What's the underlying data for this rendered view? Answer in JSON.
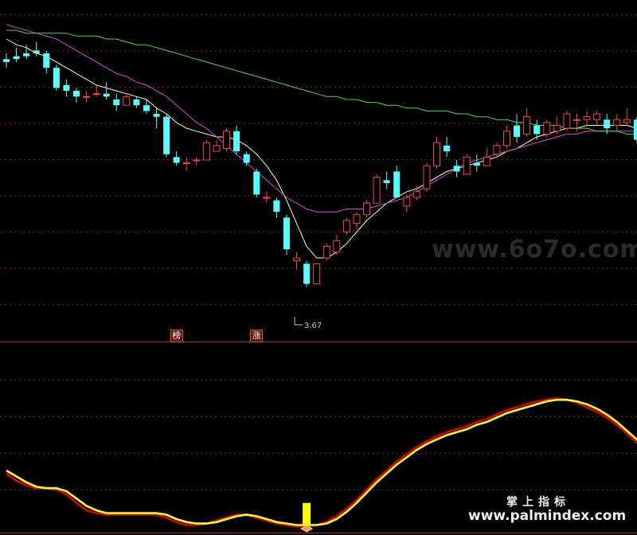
{
  "watermarks": {
    "main": "www.6o7o.com",
    "cn": "掌上指标",
    "url": "www.palmindex.com"
  },
  "badges": [
    {
      "text": "榜",
      "index": 17
    },
    {
      "text": "涨",
      "index": 25
    }
  ],
  "chart_data": [
    {
      "type": "candlestick",
      "title": "",
      "low_annotation": {
        "text": "3.67",
        "index": 18,
        "value": 3.67
      },
      "ylim": [
        3.55,
        4.6
      ],
      "grid": true,
      "candles": [
        [
          4.45,
          4.47,
          4.42,
          4.44
        ],
        [
          4.46,
          4.49,
          4.44,
          4.45
        ],
        [
          4.47,
          4.5,
          4.45,
          4.46
        ],
        [
          4.48,
          4.51,
          4.46,
          4.47
        ],
        [
          4.47,
          4.48,
          4.4,
          4.42
        ],
        [
          4.42,
          4.43,
          4.34,
          4.35
        ],
        [
          4.36,
          4.38,
          4.32,
          4.34
        ],
        [
          4.34,
          4.35,
          4.3,
          4.32
        ],
        [
          4.32,
          4.34,
          4.3,
          4.32
        ],
        [
          4.33,
          4.36,
          4.32,
          4.33
        ],
        [
          4.33,
          4.37,
          4.31,
          4.32
        ],
        [
          4.31,
          4.33,
          4.27,
          4.29
        ],
        [
          4.29,
          4.33,
          4.29,
          4.32
        ],
        [
          4.31,
          4.32,
          4.28,
          4.29
        ],
        [
          4.29,
          4.31,
          4.26,
          4.27
        ],
        [
          4.26,
          4.28,
          4.21,
          4.25
        ],
        [
          4.25,
          4.26,
          4.11,
          4.12
        ],
        [
          4.11,
          4.13,
          4.08,
          4.09
        ],
        [
          4.09,
          4.11,
          4.06,
          4.09
        ],
        [
          4.1,
          4.11,
          4.08,
          4.1
        ],
        [
          4.1,
          4.17,
          4.1,
          4.16
        ],
        [
          4.13,
          4.17,
          4.13,
          4.15
        ],
        [
          4.14,
          4.21,
          4.13,
          4.2
        ],
        [
          4.2,
          4.22,
          4.12,
          4.13
        ],
        [
          4.12,
          4.13,
          4.08,
          4.09
        ],
        [
          4.06,
          4.07,
          3.97,
          3.98
        ],
        [
          3.97,
          3.99,
          3.95,
          3.97
        ],
        [
          3.96,
          3.97,
          3.9,
          3.92
        ],
        [
          3.9,
          3.91,
          3.77,
          3.79
        ],
        [
          3.75,
          3.78,
          3.72,
          3.76
        ],
        [
          3.74,
          3.75,
          3.66,
          3.67
        ],
        [
          3.67,
          3.74,
          3.67,
          3.74
        ],
        [
          3.76,
          3.81,
          3.75,
          3.8
        ],
        [
          3.78,
          3.84,
          3.77,
          3.82
        ],
        [
          3.85,
          3.9,
          3.84,
          3.89
        ],
        [
          3.88,
          3.92,
          3.86,
          3.91
        ],
        [
          3.91,
          3.96,
          3.9,
          3.95
        ],
        [
          3.95,
          4.05,
          3.95,
          4.04
        ],
        [
          4.03,
          4.06,
          4.0,
          4.02
        ],
        [
          4.06,
          4.08,
          3.97,
          3.97
        ],
        [
          3.94,
          3.98,
          3.92,
          3.97
        ],
        [
          3.97,
          4.01,
          3.96,
          3.99
        ],
        [
          4.0,
          4.09,
          3.99,
          4.08
        ],
        [
          4.08,
          4.18,
          4.07,
          4.16
        ],
        [
          4.15,
          4.18,
          4.11,
          4.13
        ],
        [
          4.08,
          4.1,
          4.04,
          4.06
        ],
        [
          4.05,
          4.12,
          4.05,
          4.11
        ],
        [
          4.09,
          4.12,
          4.06,
          4.08
        ],
        [
          4.08,
          4.14,
          4.08,
          4.11
        ],
        [
          4.12,
          4.16,
          4.11,
          4.15
        ],
        [
          4.15,
          4.22,
          4.14,
          4.2
        ],
        [
          4.22,
          4.26,
          4.16,
          4.18
        ],
        [
          4.19,
          4.28,
          4.18,
          4.25
        ],
        [
          4.22,
          4.24,
          4.17,
          4.19
        ],
        [
          4.19,
          4.24,
          4.18,
          4.23
        ],
        [
          4.2,
          4.25,
          4.19,
          4.22
        ],
        [
          4.21,
          4.27,
          4.2,
          4.26
        ],
        [
          4.24,
          4.26,
          4.2,
          4.24
        ],
        [
          4.24,
          4.27,
          4.22,
          4.25
        ],
        [
          4.24,
          4.27,
          4.22,
          4.26
        ],
        [
          4.24,
          4.26,
          4.19,
          4.21
        ],
        [
          4.22,
          4.26,
          4.2,
          4.24
        ],
        [
          4.23,
          4.28,
          4.22,
          4.24
        ],
        [
          4.24,
          4.25,
          4.16,
          4.17
        ],
        [
          4.16,
          4.2,
          4.15,
          4.19
        ],
        [
          4.2,
          4.21,
          4.16,
          4.18
        ],
        [
          4.18,
          4.2,
          4.13,
          4.14
        ]
      ],
      "series": [
        {
          "color": "#ffffc0",
          "values": [
            4.52,
            4.5,
            4.49,
            4.47,
            4.46,
            4.44,
            4.42,
            4.4,
            4.38,
            4.36,
            4.35,
            4.34,
            4.33,
            4.32,
            4.31,
            4.28,
            4.26,
            4.23,
            4.21,
            4.2,
            4.19,
            4.18,
            4.18,
            4.17,
            4.15,
            4.12,
            4.08,
            4.03,
            3.96,
            3.88,
            3.8,
            3.76,
            3.76,
            3.78,
            3.81,
            3.85,
            3.89,
            3.92,
            3.95,
            3.97,
            3.99,
            4.0,
            4.02,
            4.04,
            4.06,
            4.07,
            4.08,
            4.09,
            4.1,
            4.11,
            4.13,
            4.14,
            4.16,
            4.18,
            4.19,
            4.2,
            4.21,
            4.21,
            4.22,
            4.22,
            4.22,
            4.22,
            4.22,
            4.21,
            4.21,
            4.2,
            4.19
          ]
        },
        {
          "color": "#e040e0",
          "values": [
            4.57,
            4.56,
            4.55,
            4.54,
            4.53,
            4.52,
            4.5,
            4.48,
            4.46,
            4.44,
            4.42,
            4.4,
            4.39,
            4.37,
            4.36,
            4.34,
            4.32,
            4.29,
            4.26,
            4.23,
            4.21,
            4.18,
            4.15,
            4.12,
            4.09,
            4.06,
            4.03,
            4.0,
            3.97,
            3.95,
            3.93,
            3.92,
            3.92,
            3.92,
            3.93,
            3.93,
            3.93,
            3.94,
            3.95,
            3.96,
            3.97,
            3.99,
            4.01,
            4.03,
            4.05,
            4.07,
            4.09,
            4.1,
            4.11,
            4.12,
            4.13,
            4.14,
            4.15,
            4.16,
            4.17,
            4.18,
            4.19,
            4.19,
            4.2,
            4.2,
            4.2,
            4.2,
            4.2,
            4.2,
            4.2,
            4.19,
            4.18
          ]
        },
        {
          "color": "#40e040",
          "values": [
            4.55,
            4.55,
            4.54,
            4.54,
            4.54,
            4.54,
            4.54,
            4.53,
            4.53,
            4.53,
            4.52,
            4.52,
            4.51,
            4.5,
            4.5,
            4.49,
            4.48,
            4.47,
            4.46,
            4.45,
            4.44,
            4.43,
            4.42,
            4.41,
            4.4,
            4.39,
            4.38,
            4.37,
            4.36,
            4.35,
            4.34,
            4.33,
            4.32,
            4.32,
            4.31,
            4.31,
            4.3,
            4.3,
            4.29,
            4.29,
            4.28,
            4.28,
            4.27,
            4.27,
            4.27,
            4.26,
            4.26,
            4.25,
            4.25,
            4.24,
            4.24,
            4.23,
            4.23,
            4.22,
            4.22,
            4.22,
            4.21,
            4.21,
            4.21,
            4.2,
            4.2,
            4.2,
            4.19,
            4.19,
            4.19,
            4.18,
            4.18
          ]
        }
      ]
    },
    {
      "type": "line",
      "title": "",
      "ylim": [
        0,
        100
      ],
      "series": [
        {
          "color": "#e00000",
          "values": [
            38,
            33,
            30,
            28,
            28,
            27,
            24,
            18,
            13,
            11,
            10,
            10,
            10,
            10,
            10,
            10,
            8,
            5,
            3,
            3,
            4,
            6,
            8,
            10,
            10,
            8,
            6,
            4,
            3,
            2,
            2,
            3,
            5,
            9,
            14,
            20,
            27,
            34,
            40,
            46,
            51,
            56,
            60,
            63,
            66,
            68,
            70,
            73,
            75,
            78,
            81,
            83,
            85,
            87,
            88,
            89,
            88,
            86,
            83,
            80,
            76,
            71,
            65,
            59,
            52,
            46,
            42
          ]
        },
        {
          "color": "#ffff20",
          "values": [
            40,
            36,
            32,
            29,
            28,
            28,
            26,
            21,
            16,
            13,
            11,
            11,
            11,
            11,
            11,
            11,
            10,
            7,
            5,
            4,
            4,
            5,
            7,
            9,
            10,
            9,
            7,
            5,
            4,
            3,
            3,
            3,
            4,
            7,
            12,
            18,
            25,
            32,
            38,
            44,
            49,
            54,
            58,
            61,
            64,
            66,
            68,
            71,
            73,
            76,
            79,
            81,
            83,
            85,
            87,
            88,
            88,
            87,
            85,
            82,
            78,
            73,
            67,
            61,
            55,
            49,
            44
          ]
        }
      ],
      "signal_bar": {
        "index": 30,
        "from": 3,
        "to": 18,
        "color": "#ffff00"
      }
    }
  ]
}
